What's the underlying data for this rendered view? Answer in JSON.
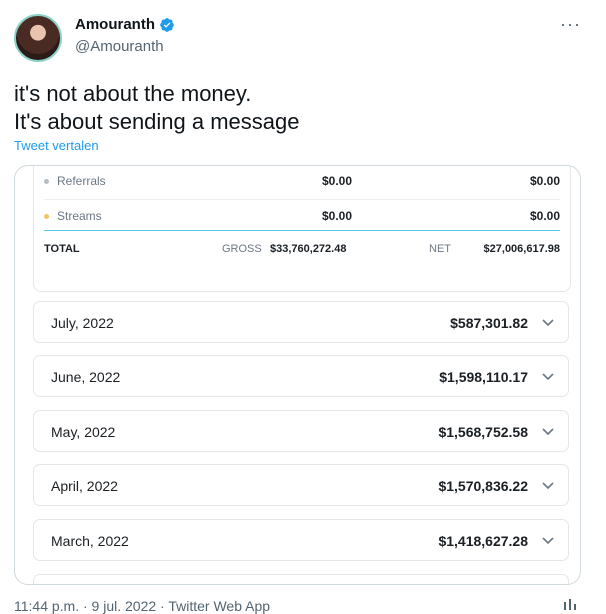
{
  "author": {
    "name": "Amouranth",
    "handle": "@Amouranth"
  },
  "more_label": "···",
  "tweet": {
    "line1": "it's not about the money.",
    "line2": "It's about sending a message",
    "translate": "Tweet vertalen"
  },
  "summary": {
    "rows": [
      {
        "label": "Referrals",
        "gross": "$0.00",
        "net": "$0.00",
        "dot_color": "#b5bcc4"
      },
      {
        "label": "Streams",
        "gross": "$0.00",
        "net": "$0.00",
        "dot_color": "#f3c26b"
      }
    ],
    "total_label": "TOTAL",
    "gross_label": "GROSS",
    "gross_value": "$33,760,272.48",
    "net_label": "NET",
    "net_value": "$27,006,617.98"
  },
  "months": [
    {
      "label": "July, 2022",
      "value": "$587,301.82"
    },
    {
      "label": "June, 2022",
      "value": "$1,598,110.17"
    },
    {
      "label": "May, 2022",
      "value": "$1,568,752.58"
    },
    {
      "label": "April, 2022",
      "value": "$1,570,836.22"
    },
    {
      "label": "March, 2022",
      "value": "$1,418,627.28"
    }
  ],
  "footer": "11:44 p.m. · 9 jul. 2022 · Twitter Web App"
}
